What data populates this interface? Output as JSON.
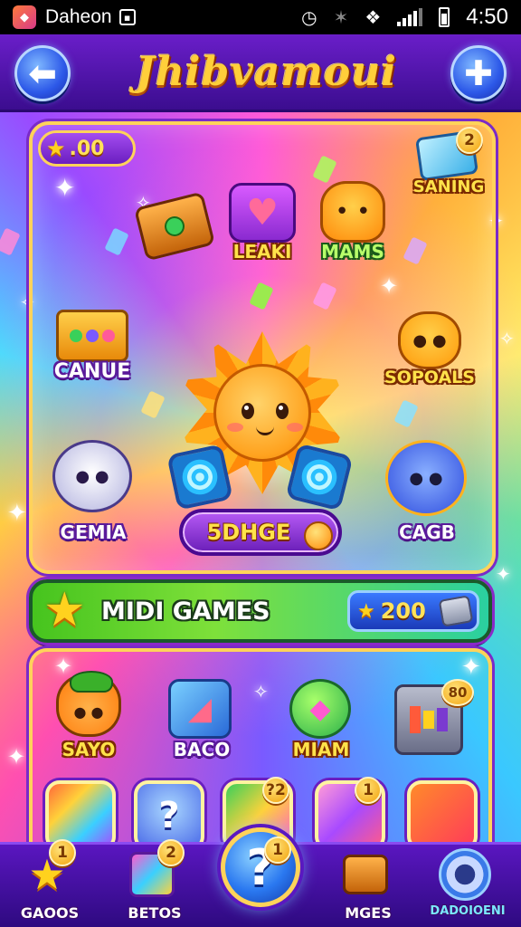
{
  "status_bar": {
    "notification_text": "Daheon",
    "time": "4:50"
  },
  "header": {
    "title": "Jhibvamoui"
  },
  "currency": {
    "coins": ".00"
  },
  "featured_games": [
    {
      "label": ""
    },
    {
      "label": "LEAKI"
    },
    {
      "label": "MAMS"
    },
    {
      "label": "SANING",
      "badge": "2"
    },
    {
      "label": "CANUE"
    },
    {
      "label": "SOPOALS"
    },
    {
      "label": "GEMIA"
    },
    {
      "label": "CAGB"
    }
  ],
  "featured_score": "5DHGE",
  "mini_games": {
    "title": "MIDI GAMES",
    "count": "200",
    "items": [
      {
        "label": "SAYO"
      },
      {
        "label": "BACO"
      },
      {
        "label": "MIAM"
      },
      {
        "label": "",
        "badge": "80"
      }
    ],
    "tiles": [
      {
        "label": ""
      },
      {
        "label": "?"
      },
      {
        "label": "",
        "badge": "?2"
      },
      {
        "label": "",
        "badge": "1"
      },
      {
        "label": ""
      }
    ]
  },
  "bottom_nav": {
    "items": [
      {
        "label": "GAOOS",
        "badge": "1"
      },
      {
        "label": "BETOS",
        "badge": "2"
      },
      {
        "label": "?",
        "badge": "1"
      },
      {
        "label": "MGES"
      },
      {
        "label": "DADOIOENI"
      }
    ]
  },
  "icons": {
    "back": "arrow-left-icon",
    "add": "plus-icon",
    "star": "star-icon",
    "help": "question-icon",
    "settings": "gear-icon"
  },
  "colors": {
    "accent": "#ffd35a",
    "header": "#6a1ec9",
    "banner_green": "#46c41e",
    "button_blue": "#2c58e8"
  }
}
